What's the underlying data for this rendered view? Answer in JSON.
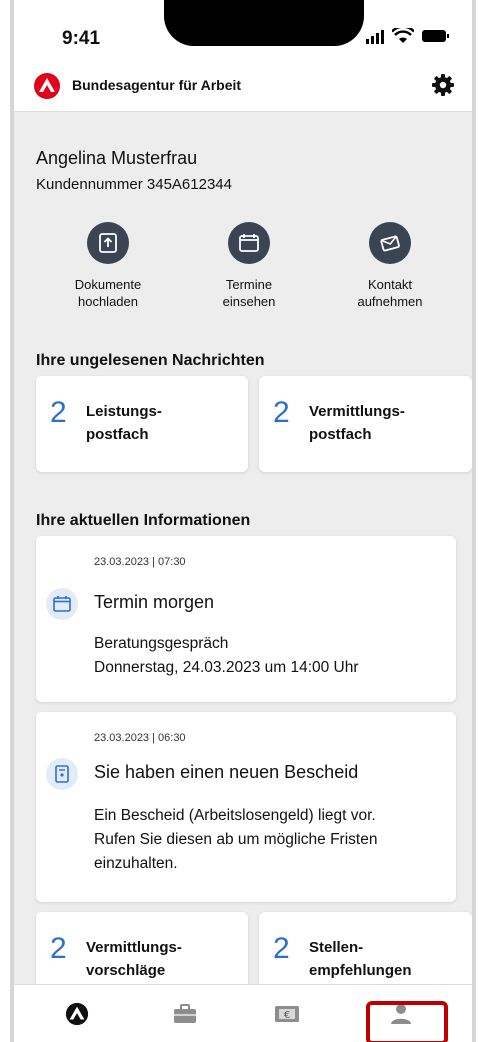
{
  "status": {
    "time": "9:41"
  },
  "header": {
    "brand": "Bundesagentur für Arbeit"
  },
  "profile": {
    "name": "Angelina Musterfrau",
    "customer_number": "Kundennummer 345A612344"
  },
  "actions": [
    {
      "label": "Dokumente\nhochladen",
      "icon": "upload-document-icon"
    },
    {
      "label": "Termine\neinsehen",
      "icon": "calendar-icon"
    },
    {
      "label": "Kontakt\naufnehmen",
      "icon": "mail-icon"
    }
  ],
  "messages": {
    "title": "Ihre ungelesenen Nachrichten",
    "tiles": [
      {
        "count": "2",
        "label": "Leistungs-\npostfach"
      },
      {
        "count": "2",
        "label": "Vermittlungs-\npostfach"
      }
    ]
  },
  "info": {
    "title": "Ihre aktuellen Informationen",
    "cards": [
      {
        "stamp": "23.03.2023 | 07:30",
        "title": "Termin morgen",
        "line1": "Beratungsgespräch",
        "line2": "Donnerstag, 24.03.2023 um 14:00 Uhr",
        "icon": "calendar-icon"
      },
      {
        "stamp": "23.03.2023 | 06:30",
        "title": "Sie haben einen neuen Bescheid",
        "line1": "Ein Bescheid (Arbeitslosengeld) liegt vor.",
        "line2": "Rufen Sie diesen ab um mögliche Fristen",
        "line3": "einzuhalten.",
        "icon": "document-icon"
      }
    ],
    "tiles": [
      {
        "count": "2",
        "label": "Vermittlungs-\nvorschläge"
      },
      {
        "count": "2",
        "label": "Stellen-\nempfehlungen"
      }
    ]
  },
  "nav": [
    "home-icon",
    "briefcase-icon",
    "euro-icon",
    "profile-icon"
  ],
  "colors": {
    "accent": "#2b6fd1",
    "brand_red": "#e2001a",
    "highlight": "#c00000"
  }
}
